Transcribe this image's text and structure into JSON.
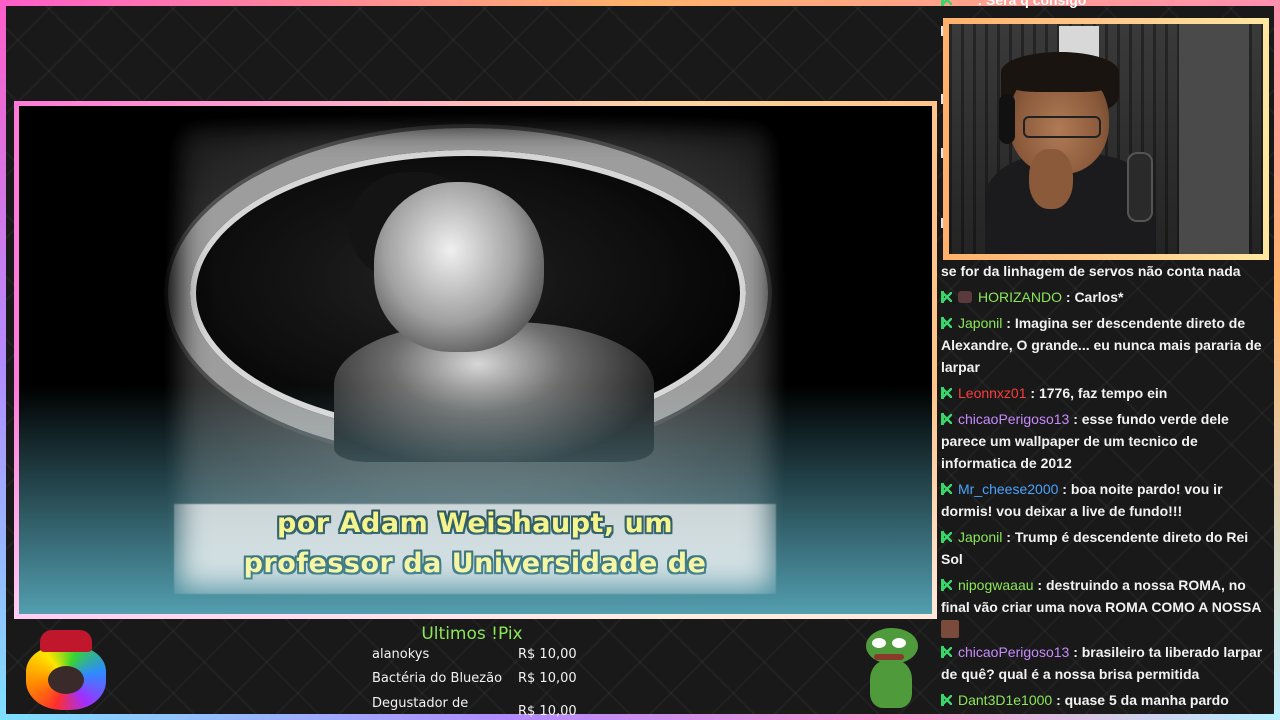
{
  "video": {
    "subtitle_line1": "por Adam Weishaupt, um",
    "subtitle_line2": "professor da Universidade de"
  },
  "chat": {
    "top_partial": {
      "user": "...",
      "text": ": Será q consigo"
    },
    "messages": [
      {
        "text": "se for da linhagem de servos não conta nada"
      },
      {
        "user": "HORIZANDO",
        "user_color": "#8ce65a",
        "text": ": Carlos*"
      },
      {
        "user": "Japonil",
        "user_color": "#8ce65a",
        "text": ": Imagina ser descendente direto de Alexandre, O grande... eu nunca mais pararia de larpar"
      },
      {
        "user": "Leonnxz01",
        "user_color": "#ff3b3b",
        "text": ": 1776, faz tempo ein"
      },
      {
        "user": "chicaoPerigoso13",
        "user_color": "#c78bff",
        "text": ": esse fundo verde dele parece um wallpaper de um tecnico de informatica de 2012"
      },
      {
        "user": "Mr_cheese2000",
        "user_color": "#4aa3ff",
        "text": ": boa noite pardo! vou ir dormis! vou deixar a live de fundo!!!"
      },
      {
        "user": "Japonil",
        "user_color": "#8ce65a",
        "text": ": Trump é descendente direto do Rei Sol"
      },
      {
        "user": "nipogwaaau",
        "user_color": "#8ce65a",
        "text": ": destruindo a nossa ROMA, no final vão criar uma nova ROMA COMO A NOSSA"
      },
      {
        "user": "chicaoPerigoso13",
        "user_color": "#c78bff",
        "text": ": brasileiro ta liberado larpar de quê? qual é a nossa brisa permitida"
      },
      {
        "user": "Dant3D1e1000",
        "user_color": "#8ce65a",
        "text": ": quase 5 da manha pardo"
      }
    ]
  },
  "pix": {
    "title": "Ultimos !Pix",
    "rows": [
      {
        "name": "alanokys",
        "value": "R$ 10,00"
      },
      {
        "name": "Bactéria do Bluezão",
        "value": "R$ 10,00"
      },
      {
        "name": "Degustador de",
        "value": "R$ 10,00"
      }
    ]
  },
  "colors": {
    "chat_badge": "#3ad46a",
    "subtitle": "#f2ee3c",
    "pix_title": "#8ce65a"
  }
}
